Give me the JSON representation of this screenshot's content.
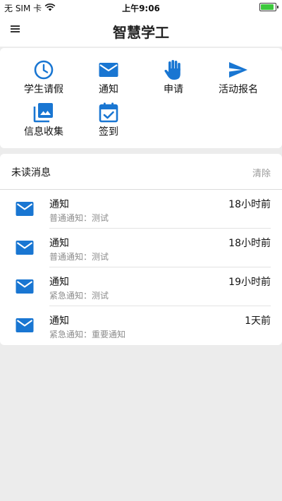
{
  "status_bar": {
    "carrier": "无 SIM 卡",
    "time": "上午9:06",
    "battery_level": 0.9,
    "battery_color": "#3cc83c"
  },
  "nav": {
    "title": "智慧学工",
    "menu_icon": "menu-icon"
  },
  "quick_actions": [
    {
      "label": "学生请假",
      "icon": "clock-icon"
    },
    {
      "label": "通知",
      "icon": "mail-icon"
    },
    {
      "label": "申请",
      "icon": "hand-icon"
    },
    {
      "label": "活动报名",
      "icon": "send-icon"
    },
    {
      "label": "信息收集",
      "icon": "photo-library-icon"
    },
    {
      "label": "签到",
      "icon": "calendar-check-icon"
    }
  ],
  "messages": {
    "header_title": "未读消息",
    "clear_label": "清除",
    "items": [
      {
        "title": "通知",
        "subtitle": "普通通知：测试",
        "time": "18小时前"
      },
      {
        "title": "通知",
        "subtitle": "普通通知：测试",
        "time": "18小时前"
      },
      {
        "title": "通知",
        "subtitle": "紧急通知：测试",
        "time": "19小时前"
      },
      {
        "title": "通知",
        "subtitle": "紧急通知：重要通知",
        "time": "1天前"
      }
    ]
  },
  "colors": {
    "accent": "#1976d2",
    "background": "#ececec"
  }
}
